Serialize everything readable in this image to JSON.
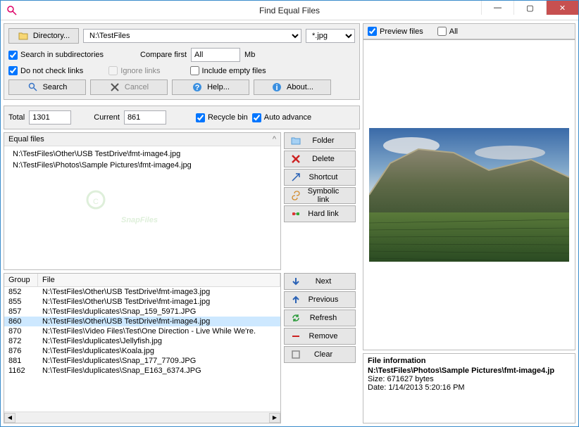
{
  "window": {
    "title": "Find Equal Files",
    "minimize": "—",
    "maximize": "▢",
    "close": "✕"
  },
  "toolbar": {
    "directory_btn": "Directory...",
    "directory_path": "N:\\TestFiles",
    "filter": "*.jpg",
    "search_subdirs": "Search in subdirectories",
    "compare_first": "Compare first",
    "compare_value": "All",
    "mb": "Mb",
    "do_not_check_links": "Do not check links",
    "ignore_links": "Ignore links",
    "include_empty": "Include empty files",
    "search": "Search",
    "cancel": "Cancel",
    "help": "Help...",
    "about": "About..."
  },
  "status": {
    "total_label": "Total",
    "total_value": "1301",
    "current_label": "Current",
    "current_value": "861",
    "recycle_bin": "Recycle bin",
    "auto_advance": "Auto advance"
  },
  "equal": {
    "header": "Equal files",
    "expand": "^",
    "items": [
      "N:\\TestFiles\\Other\\USB TestDrive\\fmt-image4.jpg",
      "N:\\TestFiles\\Photos\\Sample Pictures\\fmt-image4.jpg"
    ]
  },
  "actions": {
    "folder": "Folder",
    "delete": "Delete",
    "shortcut": "Shortcut",
    "symbolic": "Symbolic link",
    "hard": "Hard link"
  },
  "grid": {
    "col_group": "Group",
    "col_file": "File",
    "rows": [
      {
        "group": "852",
        "file": "N:\\TestFiles\\Other\\USB TestDrive\\fmt-image3.jpg"
      },
      {
        "group": "855",
        "file": "N:\\TestFiles\\Other\\USB TestDrive\\fmt-image1.jpg"
      },
      {
        "group": "857",
        "file": "N:\\TestFiles\\duplicates\\Snap_159_5971.JPG"
      },
      {
        "group": "860",
        "file": "N:\\TestFiles\\Other\\USB TestDrive\\fmt-image4.jpg"
      },
      {
        "group": "870",
        "file": "N:\\TestFiles\\Video Files\\Test\\One Direction - Live While We're."
      },
      {
        "group": "872",
        "file": "N:\\TestFiles\\duplicates\\Jellyfish.jpg"
      },
      {
        "group": "876",
        "file": "N:\\TestFiles\\duplicates\\Koala.jpg"
      },
      {
        "group": "881",
        "file": "N:\\TestFiles\\duplicates\\Snap_177_7709.JPG"
      },
      {
        "group": "1162",
        "file": "N:\\TestFiles\\duplicates\\Snap_E163_6374.JPG"
      }
    ],
    "selected_index": 3
  },
  "grid_actions": {
    "next": "Next",
    "previous": "Previous",
    "refresh": "Refresh",
    "remove": "Remove",
    "clear": "Clear"
  },
  "preview": {
    "preview_files": "Preview files",
    "all": "All"
  },
  "fileinfo": {
    "title": "File information",
    "path": "N:\\TestFiles\\Photos\\Sample Pictures\\fmt-image4.jp",
    "size": "Size: 671627 bytes",
    "date": "Date: 1/14/2013 5:20:16 PM"
  }
}
